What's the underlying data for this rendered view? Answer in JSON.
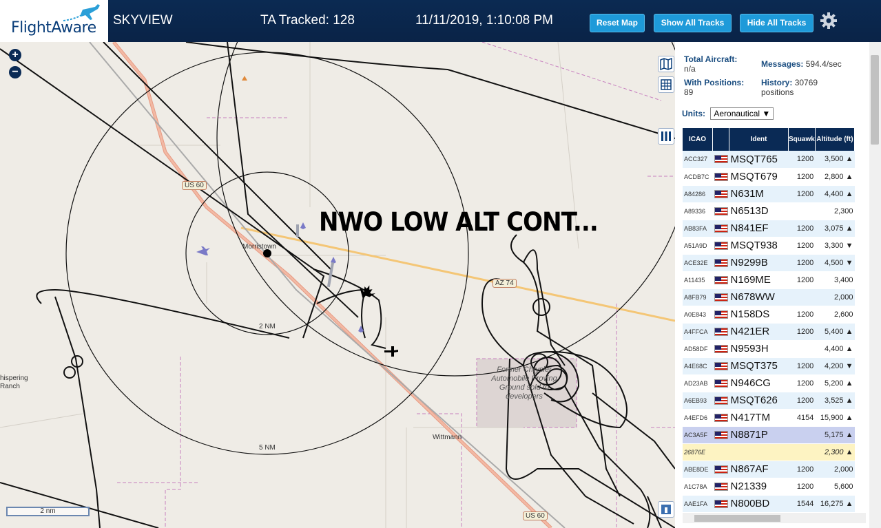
{
  "header": {
    "logo_text": "FlightAware",
    "site_name": "SKYVIEW",
    "ta_tracked": "TA Tracked: 128",
    "clock": "11/11/2019, 1:10:08 PM",
    "reset_label": "Reset Map",
    "show_label": "Show All Tracks",
    "hide_label": "Hide All Tracks"
  },
  "map": {
    "overlay_label": "NWO LOW ALT CONT...",
    "zoom_in": "+",
    "zoom_out": "−",
    "labels": {
      "town1": "Morristown",
      "town2": "Wittmann",
      "ranch": "hispering\nRanch",
      "ring_2nm": "2 NM",
      "ring_5nm": "5 NM",
      "proving_ground": "Former Chrysler Automobile Proving Ground sold to developers",
      "us60_a": "US 60",
      "az74": "AZ 74",
      "us60_b": "US 60"
    },
    "scale": "2 nm"
  },
  "stats": {
    "total_label": "Total Aircraft:",
    "total_value": "n/a",
    "messages_label": "Messages:",
    "messages_value": "594.4/sec",
    "with_pos_label": "With Positions:",
    "with_pos_value": "89",
    "history_label": "History:",
    "history_value": "30769 positions",
    "units_label": "Units:",
    "units_value": "Aeronautical"
  },
  "table": {
    "headers": [
      "ICAO",
      "",
      "Ident",
      "Squawk",
      "Altitude (ft)"
    ],
    "rows": [
      {
        "icao": "ACC327",
        "ident": "MSQT765",
        "squawk": "1200",
        "alt": "3,500 ▲",
        "style": "alt"
      },
      {
        "icao": "ACDB7C",
        "ident": "MSQT679",
        "squawk": "1200",
        "alt": "2,800 ▲",
        "style": "plain"
      },
      {
        "icao": "A84286",
        "ident": "N631M",
        "squawk": "1200",
        "alt": "4,400 ▲",
        "style": "alt"
      },
      {
        "icao": "A89336",
        "ident": "N6513D",
        "squawk": "",
        "alt": "2,300",
        "style": "plain"
      },
      {
        "icao": "AB83FA",
        "ident": "N841EF",
        "squawk": "1200",
        "alt": "3,075 ▲",
        "style": "alt"
      },
      {
        "icao": "A51A9D",
        "ident": "MSQT938",
        "squawk": "1200",
        "alt": "3,300 ▼",
        "style": "plain"
      },
      {
        "icao": "ACE32E",
        "ident": "N9299B",
        "squawk": "1200",
        "alt": "4,500 ▼",
        "style": "alt"
      },
      {
        "icao": "A11435",
        "ident": "N169ME",
        "squawk": "1200",
        "alt": "3,400",
        "style": "plain"
      },
      {
        "icao": "A8FB79",
        "ident": "N678WW",
        "squawk": "",
        "alt": "2,000",
        "style": "alt"
      },
      {
        "icao": "A0E843",
        "ident": "N158DS",
        "squawk": "1200",
        "alt": "2,600",
        "style": "plain"
      },
      {
        "icao": "A4FFCA",
        "ident": "N421ER",
        "squawk": "1200",
        "alt": "5,400 ▲",
        "style": "alt"
      },
      {
        "icao": "AD58DF",
        "ident": "N9593H",
        "squawk": "",
        "alt": "4,400 ▲",
        "style": "plain"
      },
      {
        "icao": "A4E68C",
        "ident": "MSQT375",
        "squawk": "1200",
        "alt": "4,200 ▼",
        "style": "alt"
      },
      {
        "icao": "AD23AB",
        "ident": "N946CG",
        "squawk": "1200",
        "alt": "5,200 ▲",
        "style": "plain"
      },
      {
        "icao": "A6EB93",
        "ident": "MSQT626",
        "squawk": "1200",
        "alt": "3,525 ▲",
        "style": "alt"
      },
      {
        "icao": "A4EFD6",
        "ident": "N417TM",
        "squawk": "4154",
        "alt": "15,900 ▲",
        "style": "plain"
      },
      {
        "icao": "AC3A5F",
        "ident": "N8871P",
        "squawk": "",
        "alt": "5,175 ▲",
        "style": "sel"
      },
      {
        "icao": "26876E",
        "ident": "",
        "squawk": "",
        "alt": "2,300 ▲",
        "style": "nopos"
      },
      {
        "icao": "ABE8DE",
        "ident": "N867AF",
        "squawk": "1200",
        "alt": "2,000",
        "style": "alt"
      },
      {
        "icao": "A1C78A",
        "ident": "N21339",
        "squawk": "1200",
        "alt": "5,600",
        "style": "plain"
      },
      {
        "icao": "AAE1FA",
        "ident": "N800BD",
        "squawk": "1544",
        "alt": "16,275 ▲",
        "style": "alt"
      }
    ]
  },
  "colors": {
    "header_bg": "#0a2347",
    "button": "#1e9ad9",
    "table_header": "#0a2a55",
    "row_alt": "#e6f2fb",
    "row_selected": "#c9d0ef",
    "row_no_position": "#fdf3c2"
  }
}
